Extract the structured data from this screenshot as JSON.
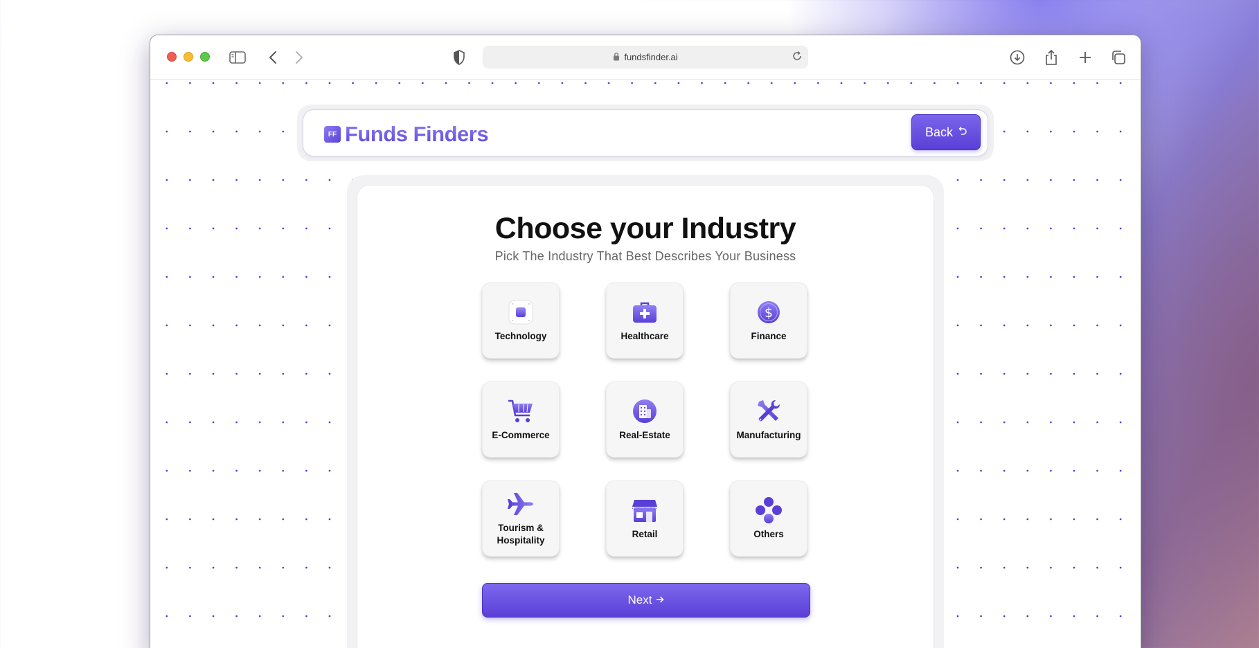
{
  "browser": {
    "url": "fundsfinder.ai"
  },
  "header": {
    "logo_mark": "FF",
    "logo_text": "Funds Finders",
    "back_label": "Back",
    "back_icon": "undo-arrow-icon"
  },
  "main": {
    "title": "Choose your Industry",
    "subtitle": "Pick The Industry That Best Describes Your Business",
    "industries": [
      {
        "label": "Technology",
        "icon": "chip-icon"
      },
      {
        "label": "Healthcare",
        "icon": "medical-bag-icon"
      },
      {
        "label": "Finance",
        "icon": "dollar-coin-icon"
      },
      {
        "label": "E-Commerce",
        "icon": "shopping-cart-icon"
      },
      {
        "label": "Real-Estate",
        "icon": "building-icon"
      },
      {
        "label": "Manufacturing",
        "icon": "tools-icon"
      },
      {
        "label": "Tourism & Hospitality",
        "icon": "airplane-icon"
      },
      {
        "label": "Retail",
        "icon": "storefront-icon"
      },
      {
        "label": "Others",
        "icon": "dots-cluster-icon"
      }
    ],
    "next_label": "Next",
    "next_icon": "arrow-right-icon"
  },
  "colors": {
    "accent": "#5a3fd6",
    "accent_light": "#8f80f4"
  }
}
